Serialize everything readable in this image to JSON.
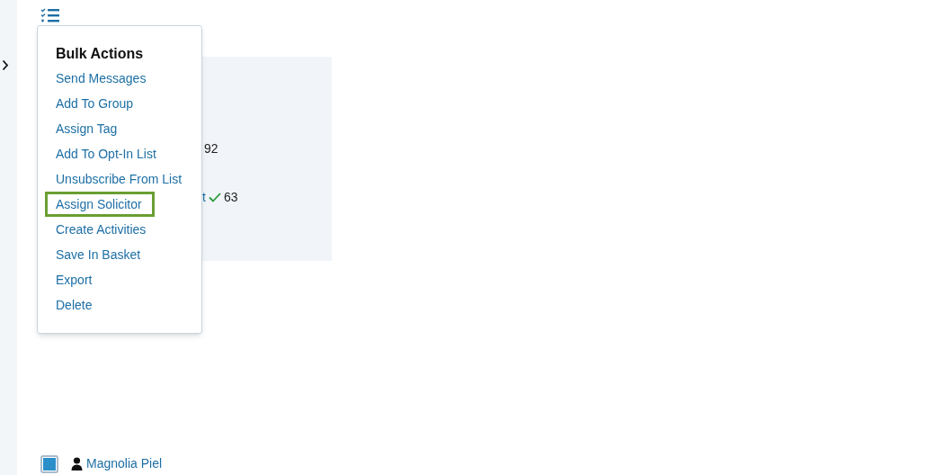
{
  "bulk_actions_menu": {
    "title": "Bulk Actions",
    "items": [
      {
        "label": "Send Messages",
        "selected": false
      },
      {
        "label": "Add To Group",
        "selected": false
      },
      {
        "label": "Assign Tag",
        "selected": false
      },
      {
        "label": "Add To Opt-In List",
        "selected": false
      },
      {
        "label": "Unsubscribe From List",
        "selected": false
      },
      {
        "label": "Assign Solicitor",
        "selected": true
      },
      {
        "label": "Create Activities",
        "selected": false
      },
      {
        "label": "Save In Basket",
        "selected": false
      },
      {
        "label": "Export",
        "selected": false
      },
      {
        "label": "Delete",
        "selected": false
      }
    ]
  },
  "panel": {
    "count_1": "92",
    "label_2": "t",
    "count_2": "63"
  },
  "row": {
    "checked": true,
    "name": "Magnolia Piel"
  }
}
